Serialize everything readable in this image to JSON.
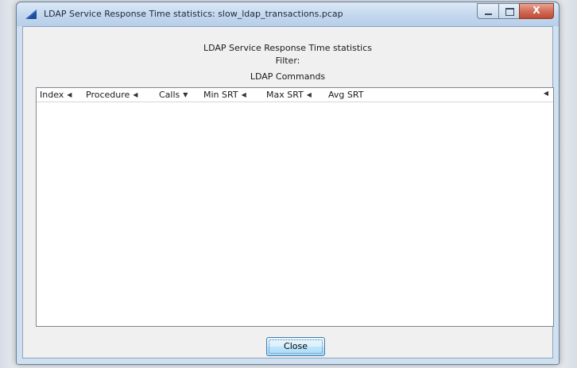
{
  "window": {
    "title": "LDAP Service Response Time statistics: slow_ldap_transactions.pcap",
    "close_glyph": "X"
  },
  "header": {
    "heading": "LDAP Service Response Time statistics",
    "filter_label": "Filter:",
    "section_title": "LDAP Commands"
  },
  "table": {
    "columns": [
      {
        "label": "Index",
        "sort_icon": "triangle-left-icon"
      },
      {
        "label": "Procedure",
        "sort_icon": "triangle-left-icon"
      },
      {
        "label": "Calls",
        "sort_icon": "triangle-down-icon"
      },
      {
        "label": "Min SRT",
        "sort_icon": "triangle-left-icon"
      },
      {
        "label": "Max SRT",
        "sort_icon": "triangle-left-icon"
      },
      {
        "label": "Avg SRT",
        "sort_icon": "triangle-left-icon"
      }
    ],
    "rows": []
  },
  "buttons": {
    "close_label": "Close"
  },
  "colors": {
    "titlebar": "#c3d7ee",
    "close_caption": "#c04a34",
    "button_border": "#3c7fb1"
  }
}
